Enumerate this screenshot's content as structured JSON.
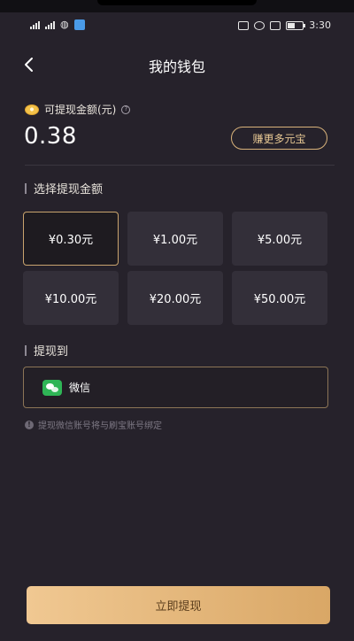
{
  "status_bar": {
    "time": "3:30",
    "battery_level": 0.5
  },
  "header": {
    "title": "我的钱包",
    "back_icon": "chevron-left-icon"
  },
  "balance": {
    "label": "可提现金额(元)",
    "value": "0.38",
    "help_icon": "question-icon",
    "earn_button_label": "赚更多元宝"
  },
  "amount_section": {
    "title": "选择提现金额",
    "options": [
      {
        "label": "¥0.30元",
        "selected": true
      },
      {
        "label": "¥1.00元",
        "selected": false
      },
      {
        "label": "¥5.00元",
        "selected": false
      },
      {
        "label": "¥10.00元",
        "selected": false
      },
      {
        "label": "¥20.00元",
        "selected": false
      },
      {
        "label": "¥50.00元",
        "selected": false
      }
    ]
  },
  "withdraw_to": {
    "title": "提现到",
    "method_label": "微信",
    "method_icon": "wechat-icon"
  },
  "note": {
    "text": "提现微信账号将与刷宝账号绑定",
    "icon": "info-icon"
  },
  "submit_button": {
    "label": "立即提现"
  },
  "colors": {
    "background": "#26222b",
    "accent_gold": "#d8b27a",
    "button_gradient_start": "#f0c892",
    "button_gradient_end": "#d9a766",
    "wechat_green": "#2fb556"
  }
}
